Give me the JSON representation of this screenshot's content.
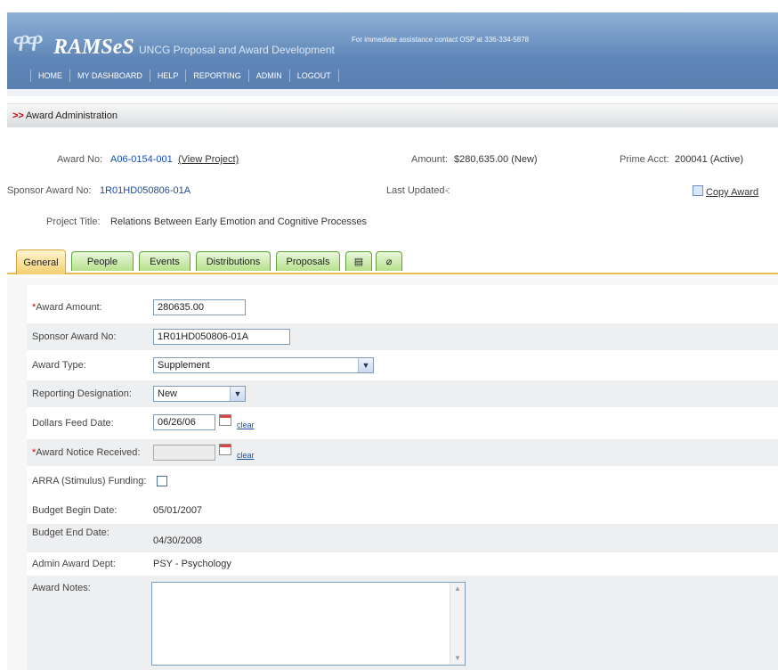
{
  "header": {
    "brand": "RAMSeS",
    "subtitle": "UNCG Proposal and Award Development",
    "assistance": "For immediate assistance contact OSP at 336-334-5878",
    "nav": [
      "HOME",
      "MY DASHBOARD",
      "HELP",
      "REPORTING",
      "ADMIN",
      "LOGOUT"
    ]
  },
  "section": {
    "title": "Award Administration"
  },
  "award": {
    "award_no_label": "Award No:",
    "award_no": "A06-0154-001",
    "view_project": "(View Project)",
    "amount_label": "Amount:",
    "amount": "$280,635.00 (New)",
    "prime_label": "Prime Acct:",
    "prime": "200041 (Active)",
    "sponsor_label": "Sponsor Award No:",
    "sponsor_no": "1R01HD050806-01A",
    "updated_label": "Last Updated :",
    "updated": "-",
    "copy_award": "Copy Award",
    "project_label": "Project Title:",
    "project_title": "Relations Between Early Emotion and Cognitive Processes"
  },
  "tabs": [
    "General",
    "People",
    "Events",
    "Distributions",
    "Proposals"
  ],
  "tab_icons": [
    "document-icon",
    "attachment-icon"
  ],
  "form": {
    "award_amount_label": "Award Amount:",
    "award_amount": "280635.00",
    "sponsor_award_label": "Sponsor Award No:",
    "sponsor_award": "1R01HD050806-01A",
    "award_type_label": "Award Type:",
    "award_type": "Supplement",
    "reporting_label": "Reporting Designation:",
    "reporting": "New",
    "dollars_feed_label": "Dollars Feed Date:",
    "dollars_feed": "06/26/06",
    "clear": "clear",
    "notice_label": "Award Notice Received:",
    "notice": "",
    "arra_label": "ARRA (Stimulus) Funding:",
    "budget_begin_label": "Budget Begin Date:",
    "budget_begin": "05/01/2007",
    "budget_end_label": "Budget End Date:",
    "budget_end": "04/30/2008",
    "admin_dept_label": "Admin Award Dept:",
    "admin_dept": "PSY - Psychology",
    "notes_label": "Award Notes:",
    "notes": ""
  }
}
